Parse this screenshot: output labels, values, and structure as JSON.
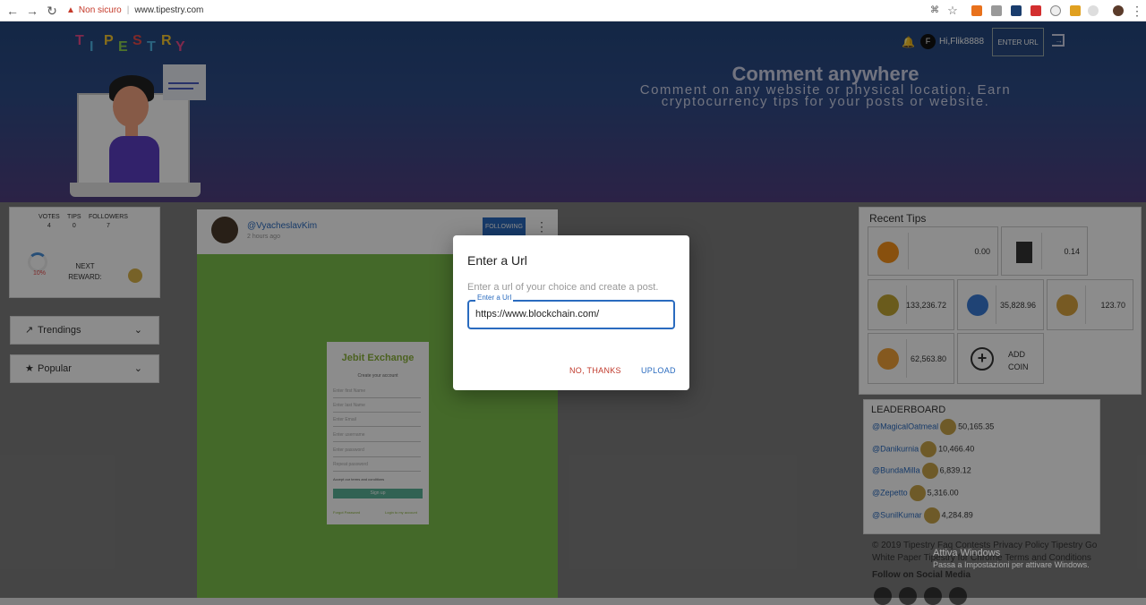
{
  "browser": {
    "warning": "Non sicuro",
    "url": "www.tipestry.com"
  },
  "header": {
    "logo": [
      "T",
      "I",
      "P",
      "E",
      "S",
      "T",
      "R",
      "Y"
    ],
    "title": "Comment anywhere",
    "subtitle_l1": "Comment on any website or physical location. Earn",
    "subtitle_l2": "cryptocurrency tips for your posts or website.",
    "avatar_letter": "F",
    "user": "Hi,Flik8888",
    "enter_url": "ENTER URL"
  },
  "profile": {
    "stats": [
      {
        "label": "VOTES",
        "value": "4"
      },
      {
        "label": "TIPS",
        "value": "0"
      },
      {
        "label": "FOLLOWERS",
        "value": "7"
      }
    ],
    "progress": "10%",
    "progress_fraction": 0.1,
    "next_reward": "NEXT REWARD:"
  },
  "sidebar": {
    "trendings": "Trendings",
    "popular": "Popular"
  },
  "post": {
    "user": "@VyacheslavKim",
    "time": "2 hours ago",
    "follow": "FOLLOWING",
    "site_title": "Jebit Exchange",
    "site_subtitle": "Create your account",
    "fields": [
      "Enter first Name",
      "Enter last Name",
      "Enter Email",
      "Enter username",
      "Enter password",
      "Repeat password"
    ],
    "accept": "Accept our terms and conditions",
    "signup": "Sign up",
    "link_left": "Forgot Password",
    "link_right": "Login to my account"
  },
  "recent_tips": {
    "title": "Recent Tips",
    "tips": [
      {
        "value": "0.00",
        "color": "#f7931a"
      },
      {
        "value": "0.14",
        "color": "#333333"
      },
      {
        "value": "133,236.72",
        "color": "#c2a633"
      },
      {
        "value": "35,828.96",
        "color": "#3a7bd5"
      },
      {
        "value": "123.70",
        "color": "#d9a441"
      },
      {
        "value": "62,563.80",
        "color": "#f2a33a"
      }
    ],
    "add_coin_l1": "ADD",
    "add_coin_l2": "COIN"
  },
  "leaderboard": {
    "title": "LEADERBOARD",
    "rows": [
      {
        "user": "@MagicalOatmeal",
        "value": "50,165.35"
      },
      {
        "user": "@Danikurnia",
        "value": "10,466.40"
      },
      {
        "user": "@BundaMilla",
        "value": "6,839.12"
      },
      {
        "user": "@Zepetto",
        "value": "5,316.00"
      },
      {
        "user": "@SunilKumar",
        "value": "4,284.89"
      }
    ]
  },
  "footer": {
    "line1": "© 2019 Tipestry  Faq  Contests  Privacy Policy  Tipestry Go",
    "line2": "White Paper  Tipestry for Chrome  Terms and Conditions",
    "social": "Follow on Social Media",
    "watermark_l1": "Attiva Windows",
    "watermark_l2": "Passa a Impostazioni per attivare Windows."
  },
  "dialog": {
    "title": "Enter a Url",
    "text": "Enter a url of your choice and create a post.",
    "label": "Enter a Url",
    "value": "https://www.blockchain.com/",
    "cancel": "NO, THANKS",
    "upload": "UPLOAD"
  },
  "colors": {
    "accent": "#2a6bbf",
    "cancel": "#c0392b",
    "hero_top": "#24477e",
    "hero_bottom": "#503f80",
    "post_bg": "#7cc04b"
  }
}
